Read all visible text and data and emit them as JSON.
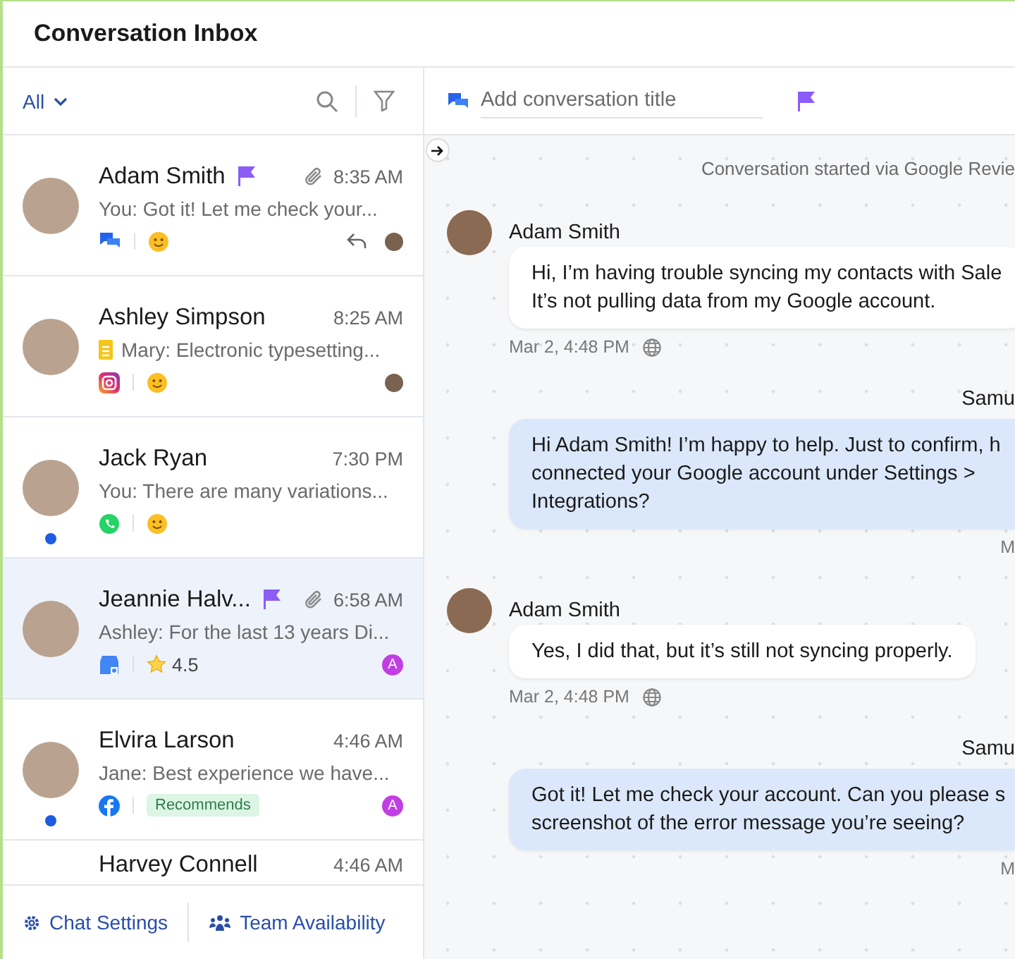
{
  "header": {
    "title": "Conversation Inbox"
  },
  "list_toolbar": {
    "filter": "All"
  },
  "conversations": [
    {
      "name": "Adam Smith",
      "flagged": true,
      "attachment": true,
      "time": "8:35 AM",
      "preview": "You: Got it! Let me check your...",
      "note": false,
      "channel": {
        "kind": "chat"
      },
      "badge": {
        "kind": "emoji"
      },
      "replied": true,
      "assignee": {
        "kind": "photo"
      },
      "unread": false,
      "selected": false
    },
    {
      "name": "Ashley Simpson",
      "flagged": false,
      "attachment": false,
      "time": "8:25 AM",
      "preview": "Mary: Electronic typesetting...",
      "note": true,
      "channel": {
        "kind": "instagram"
      },
      "badge": {
        "kind": "emoji"
      },
      "replied": false,
      "assignee": {
        "kind": "photo"
      },
      "unread": false,
      "selected": false
    },
    {
      "name": "Jack Ryan",
      "flagged": false,
      "attachment": false,
      "time": "7:30 PM",
      "preview": "You: There are many variations...",
      "note": false,
      "channel": {
        "kind": "whatsapp"
      },
      "badge": {
        "kind": "emoji"
      },
      "replied": false,
      "assignee": {
        "kind": "none"
      },
      "unread": true,
      "selected": false
    },
    {
      "name": "Jeannie Halv...",
      "flagged": true,
      "attachment": true,
      "time": "6:58 AM",
      "preview": "Ashley: For the last 13 years Di...",
      "note": false,
      "channel": {
        "kind": "google_business"
      },
      "badge": {
        "kind": "rating",
        "text": "4.5"
      },
      "replied": false,
      "assignee": {
        "kind": "letter",
        "letter": "A"
      },
      "unread": false,
      "selected": true
    },
    {
      "name": "Elvira Larson",
      "flagged": false,
      "attachment": false,
      "time": "4:46 AM",
      "preview": "Jane: Best experience we have...",
      "note": false,
      "channel": {
        "kind": "facebook"
      },
      "badge": {
        "kind": "label",
        "text": "Recommends"
      },
      "replied": false,
      "assignee": {
        "kind": "letter",
        "letter": "A"
      },
      "unread": true,
      "selected": false
    },
    {
      "name": "Harvey Connell",
      "flagged": false,
      "attachment": false,
      "time": "4:46 AM",
      "unread": false,
      "selected": false
    }
  ],
  "footer": {
    "settings": "Chat Settings",
    "availability": "Team Availability"
  },
  "chat": {
    "title_placeholder": "Add conversation title",
    "flagged": true,
    "notice": "Conversation started via Google Revie",
    "messages": [
      {
        "kind": "incoming",
        "sender": "Adam Smith",
        "text": "Hi, I’m having trouble syncing my contacts with Sale\nIt’s not pulling data from my Google account.",
        "time": "Mar 2, 4:48 PM"
      },
      {
        "kind": "outgoing",
        "sender": "Samu",
        "text": "Hi Adam Smith! I’m happy to help. Just to confirm, h\nconnected your Google account under Settings >\nIntegrations?",
        "time": "M"
      },
      {
        "kind": "incoming",
        "sender": "Adam Smith",
        "text": "Yes, I did that, but it’s still not syncing properly.",
        "time": "Mar 2, 4:48 PM"
      },
      {
        "kind": "outgoing",
        "sender": "Samu",
        "text": "Got it! Let me check your account. Can you please s\nscreenshot of the error message you’re seeing?",
        "time": "M"
      }
    ]
  }
}
